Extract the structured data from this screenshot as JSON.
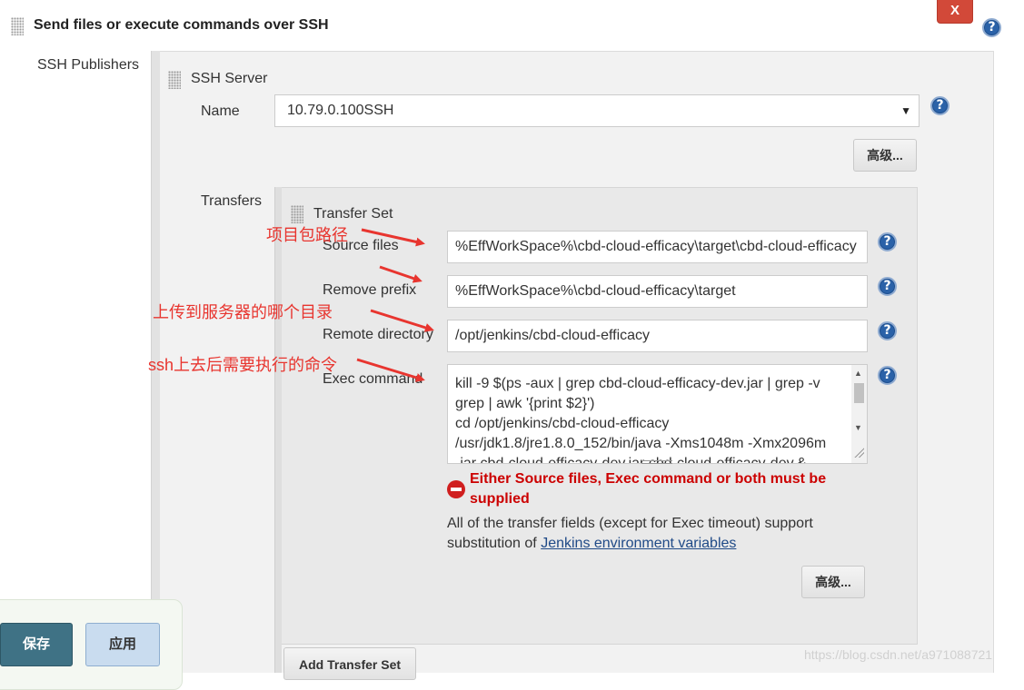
{
  "section": {
    "title": "Send files or execute commands over SSH",
    "close_label": "X"
  },
  "publishers": {
    "label": "SSH Publishers",
    "server": {
      "title": "SSH Server",
      "name_label": "Name",
      "name_value": "10.79.0.100SSH",
      "advanced_label": "高级..."
    }
  },
  "transfers": {
    "label": "Transfers",
    "set_title": "Transfer Set",
    "source_files_label": "Source files",
    "source_files_value": "%EffWorkSpace%\\cbd-cloud-efficacy\\target\\cbd-cloud-efficacy",
    "remove_prefix_label": "Remove prefix",
    "remove_prefix_value": "%EffWorkSpace%\\cbd-cloud-efficacy\\target",
    "remote_dir_label": "Remote directory",
    "remote_dir_value": "/opt/jenkins/cbd-cloud-efficacy",
    "exec_label": "Exec command",
    "exec_lines": [
      "kill -9 $(ps -aux | grep cbd-cloud-efficacy-dev.jar | grep -v",
      "grep  | awk '{print $2}')",
      "cd  /opt/jenkins/cbd-cloud-efficacy",
      "/usr/jdk1.8/jre1.8.0_152/bin/java -Xms1048m -Xmx2096m",
      "-jar cbd-cloud-efficacy-dev.jar cbd-cloud-efficacy-dev.&"
    ],
    "error_text": "Either Source files, Exec command or both must be supplied",
    "info_text": "All of the transfer fields (except for Exec timeout) support substitution of",
    "info_link": "Jenkins environment variables",
    "advanced_label": "高级...",
    "add_label": "Add Transfer Set"
  },
  "bottom": {
    "save_label": "保存",
    "apply_label": "应用"
  },
  "annotations": {
    "a1": "项目包路径",
    "a2": "上传到服务器的哪个目录",
    "a3_prefix": "ssh",
    "a3_rest": "上去后需要执行的命令"
  },
  "watermark": "https://blog.csdn.net/a971088721",
  "colors": {
    "accent": "#2b62a8",
    "error": "#cc0000",
    "close": "#d24939",
    "save": "#3f7285"
  }
}
